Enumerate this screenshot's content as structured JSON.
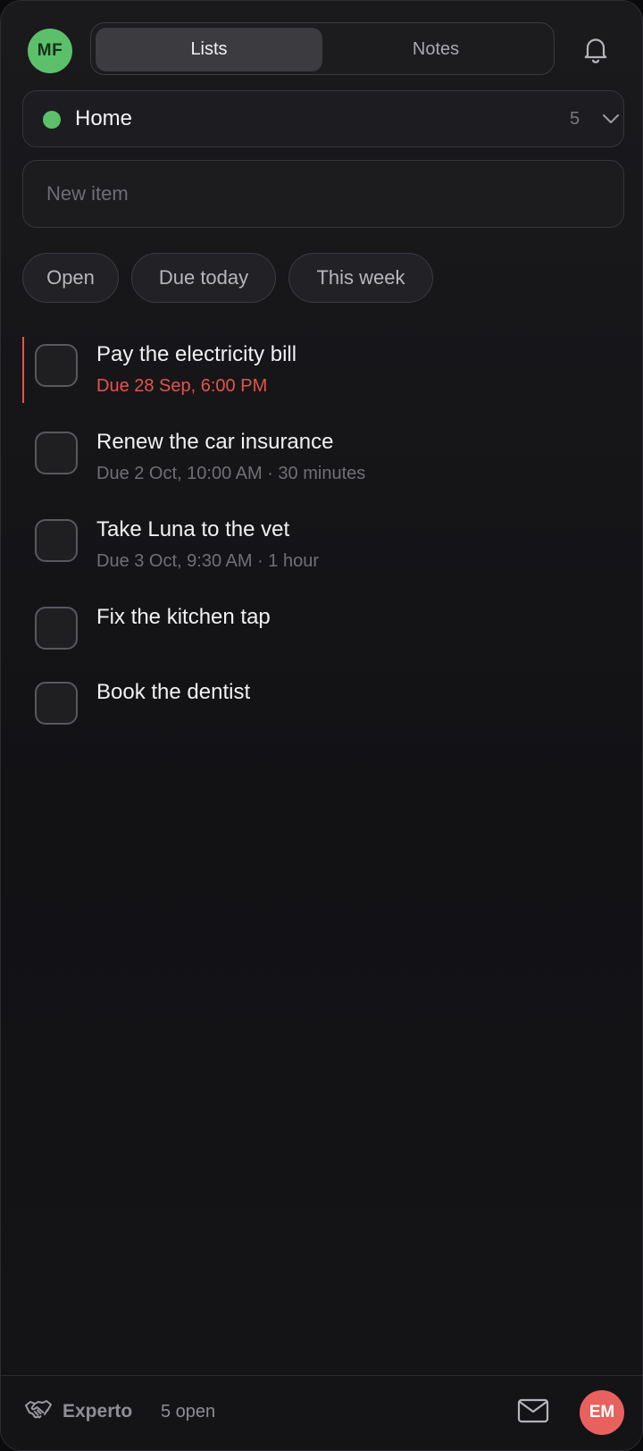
{
  "header": {
    "user_initials": "MF",
    "tabs": [
      {
        "label": "Lists",
        "active": true
      },
      {
        "label": "Notes",
        "active": false
      }
    ],
    "notifications_icon": "bell-icon"
  },
  "list_selector": {
    "name": "Home",
    "count": "5",
    "dot_color": "#5cc06a",
    "chevron_icon": "chevron-down-icon"
  },
  "new_item": {
    "placeholder": "New item",
    "value": ""
  },
  "filters": [
    {
      "label": "Open"
    },
    {
      "label": "Due today"
    },
    {
      "label": "This week"
    }
  ],
  "tasks": [
    {
      "title": "Pay the electricity bill",
      "meta": "Due 28 Sep, 6:00 PM",
      "overdue": true
    },
    {
      "title": "Renew the car insurance",
      "meta": "Due 2 Oct, 10:00 AM · 30 minutes",
      "overdue": false
    },
    {
      "title": "Take Luna to the vet",
      "meta": "Due 3 Oct, 9:30 AM · 1 hour",
      "overdue": false
    },
    {
      "title": "Fix the kitchen tap",
      "meta": "",
      "overdue": false
    },
    {
      "title": "Book the dentist",
      "meta": "",
      "overdue": false
    }
  ],
  "footer": {
    "brand_icon": "handshake-icon",
    "brand_name": "Experto",
    "open_count": "5 open",
    "mail_icon": "mail-icon",
    "user_initials": "EM"
  },
  "colors": {
    "accent_green": "#5cc06a",
    "overdue_red": "#e5534b",
    "avatar_red": "#e9615e"
  }
}
